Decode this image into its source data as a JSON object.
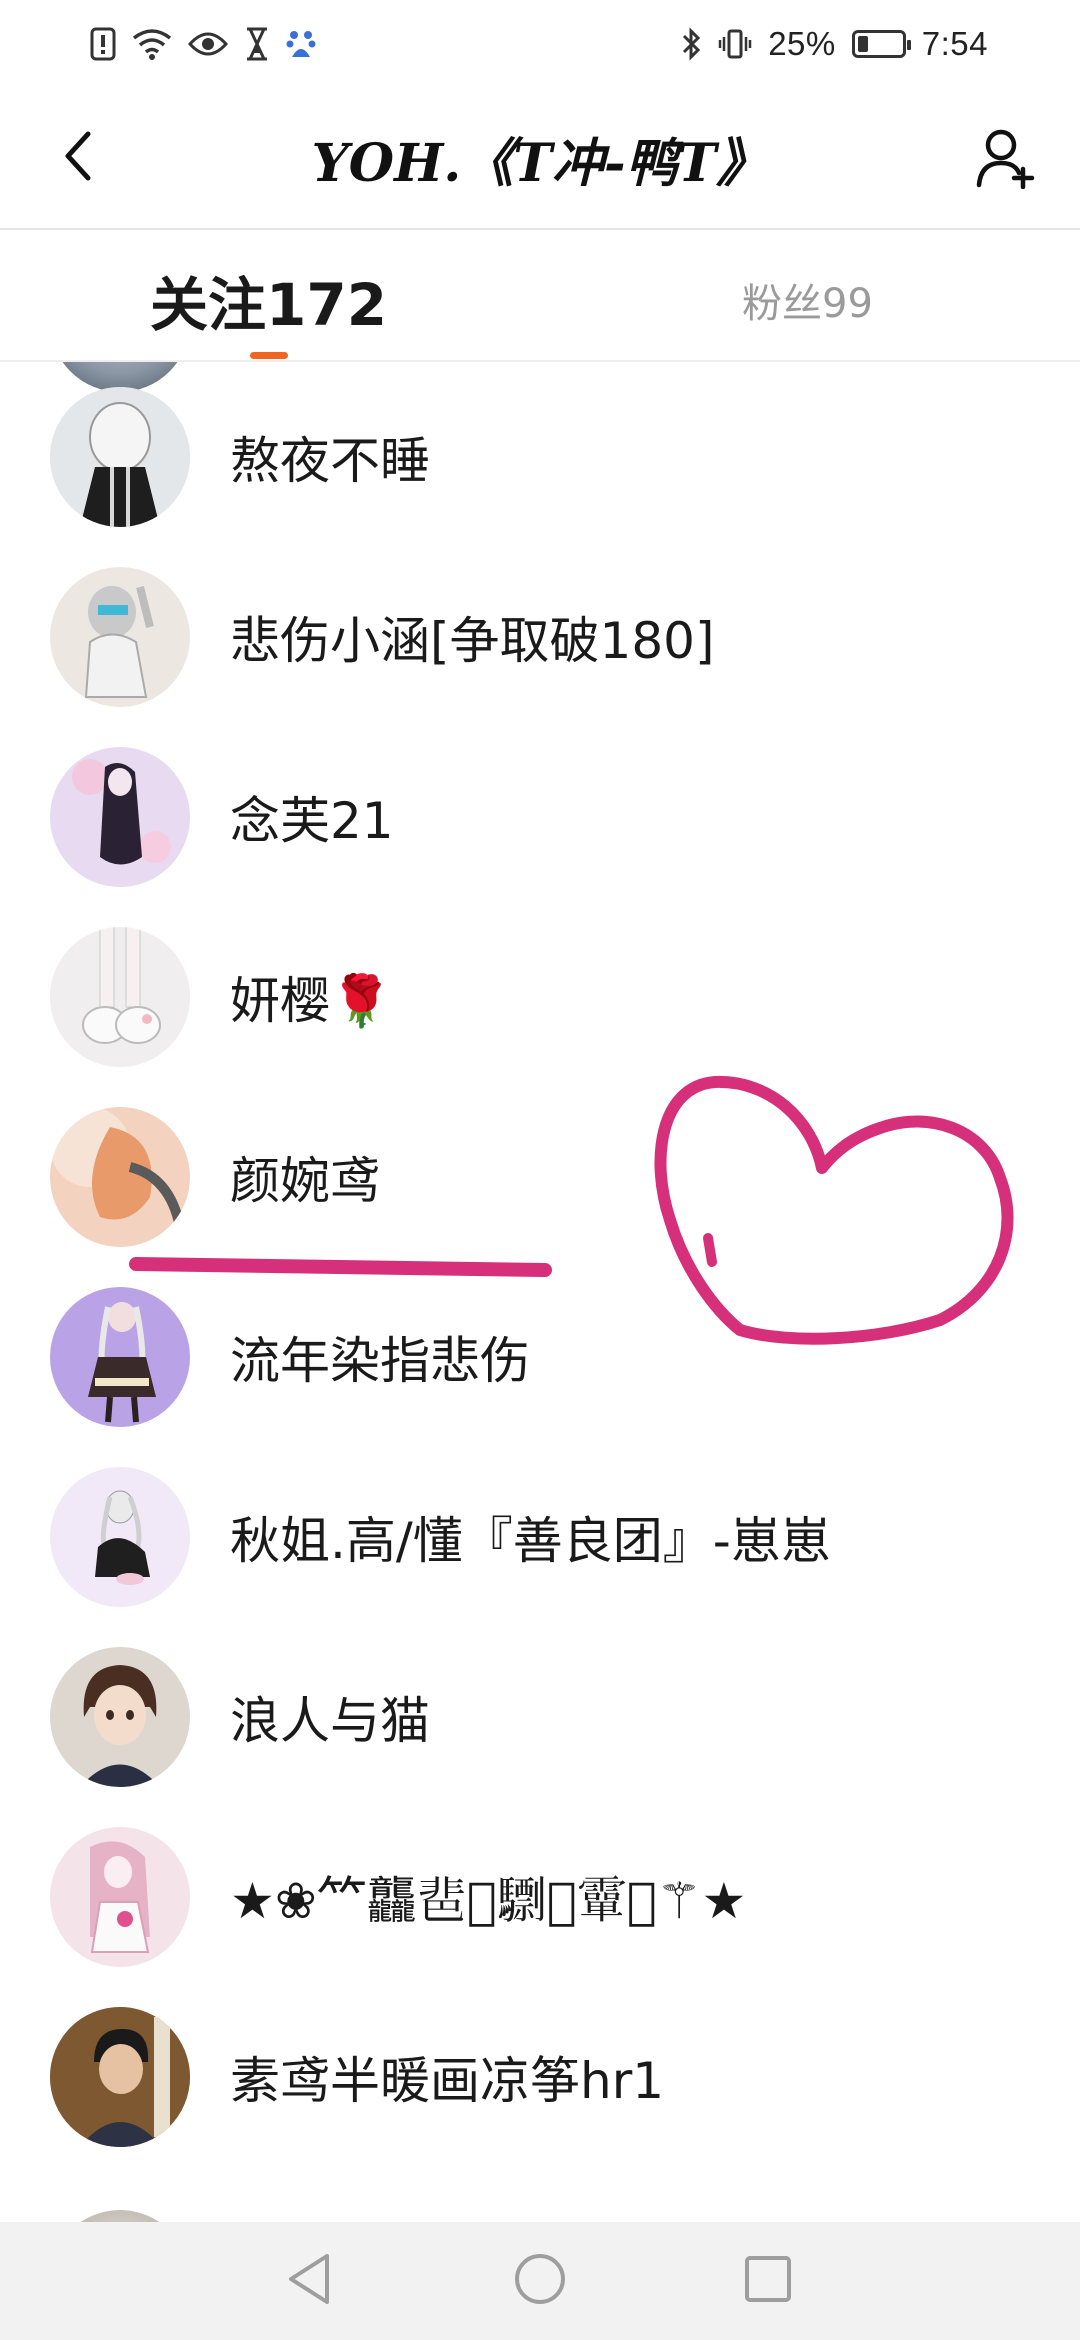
{
  "status_bar": {
    "icons_left": [
      "alert-icon",
      "wifi-icon",
      "eye-icon",
      "hourglass-icon",
      "baidu-icon"
    ],
    "icons_right": [
      "bluetooth-icon",
      "vibrate-icon"
    ],
    "battery_percent": "25%",
    "battery_level": 0.25,
    "time": "7:54"
  },
  "header": {
    "title": "YOH.《T冲-鸭T》",
    "back_icon": "chevron-left-icon",
    "add_user_icon": "add-user-icon"
  },
  "tabs": {
    "following": "关注172",
    "fans": "粉丝99",
    "active": "following",
    "accent_color": "#f06520"
  },
  "list": {
    "items": [
      {
        "name": "熬夜不睡"
      },
      {
        "name": "悲伤小涵[争取破180]"
      },
      {
        "name": "念芙21"
      },
      {
        "name": "妍樱🌹"
      },
      {
        "name": "颜婉鸢"
      },
      {
        "name": "流年染指悲伤"
      },
      {
        "name": "秋姐.高/懂『善良团』-崽崽"
      },
      {
        "name": "浪人与猫"
      },
      {
        "name": "★❀𥫗龘𩇯𩵃𩦠𪋽𩅦𩙪⚚★"
      },
      {
        "name": "素鸢半暖画凉筝hr1"
      }
    ]
  },
  "annotations": {
    "color": "#d6307a",
    "shapes": [
      "underline",
      "heart"
    ]
  },
  "nav_bar": {
    "buttons": [
      "back-triangle-icon",
      "home-circle-icon",
      "recents-square-icon"
    ]
  }
}
